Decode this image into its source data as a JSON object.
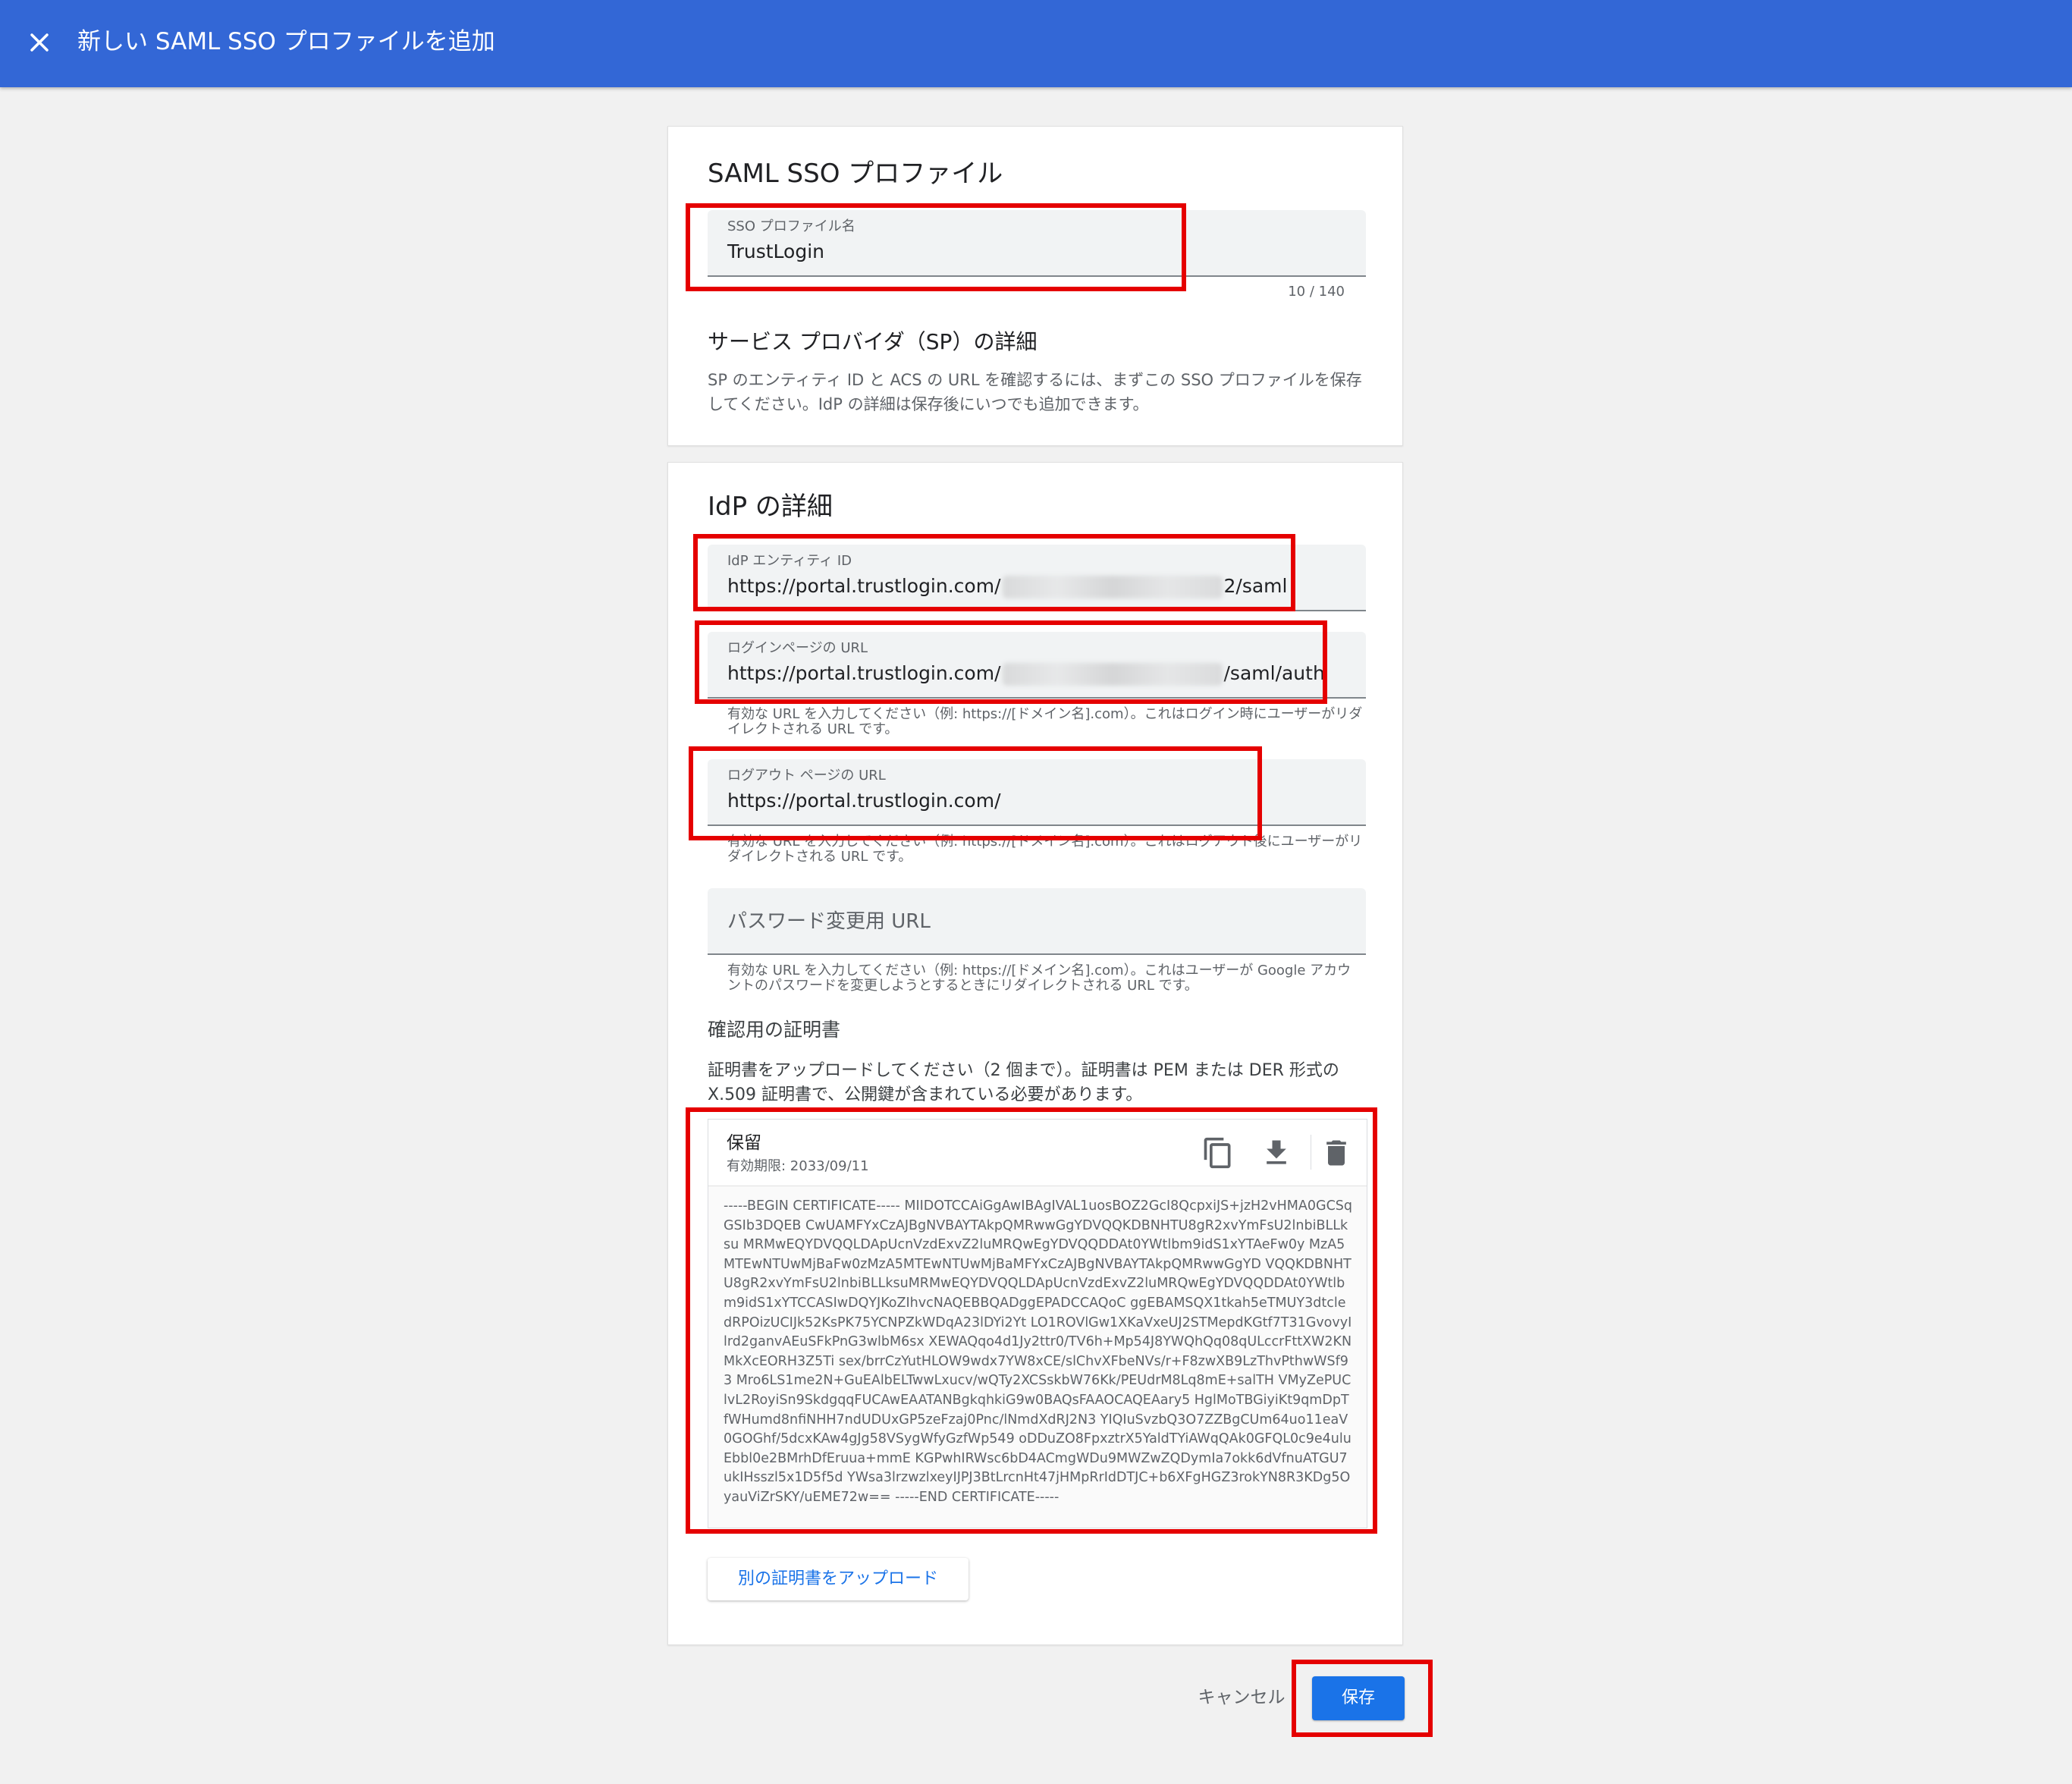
{
  "header": {
    "title": "新しい SAML SSO プロファイルを追加"
  },
  "profile_card": {
    "title": "SAML SSO プロファイル",
    "name_field": {
      "label": "SSO プロファイル名",
      "value": "TrustLogin",
      "counter": "10 / 140"
    },
    "sp_title": "サービス プロバイダ（SP）の詳細",
    "sp_desc": "SP のエンティティ ID と ACS の URL を確認するには、まずこの SSO プロファイルを保存してください。IdP の詳細は保存後にいつでも追加できます。"
  },
  "idp_card": {
    "title": "IdP の詳細",
    "entity_id": {
      "label": "IdP エンティティ ID",
      "value_prefix": "https://portal.trustlogin.com/",
      "value_suffix": "2/saml"
    },
    "login_url": {
      "label": "ログインページの URL",
      "value_prefix": "https://portal.trustlogin.com/",
      "value_suffix": "/saml/auth",
      "helper": "有効な URL を入力してください（例: https://[ドメイン名].com）。これはログイン時にユーザーがリダイレクトされる URL です。"
    },
    "logout_url": {
      "label": "ログアウト ページの URL",
      "value": "https://portal.trustlogin.com/",
      "helper": "有効な URL を入力してください（例: https://[ドメイン名].com）。これはログアウト後にユーザーがリダイレクトされる URL です。"
    },
    "password_url": {
      "placeholder": "パスワード変更用 URL",
      "helper": "有効な URL を入力してください（例: https://[ドメイン名].com）。これはユーザーが Google アカウントのパスワードを変更しようとするときにリダイレクトされる URL です。"
    },
    "cert_title": "確認用の証明書",
    "cert_desc": "証明書をアップロードしてください（2 個まで）。証明書は PEM または DER 形式の X.509 証明書で、公開鍵が含まれている必要があります。",
    "certificate": {
      "status": "保留",
      "expiry": "有効期限: 2033/09/11",
      "actions": [
        "copy-icon",
        "download-icon",
        "delete-icon"
      ],
      "text": "-----BEGIN CERTIFICATE----- MIIDOTCCAiGgAwIBAgIVAL1uosBOZ2GcI8QcpxiJS+jzH2vHMA0GCSqGSIb3DQEB CwUAMFYxCzAJBgNVBAYTAkpQMRwwGgYDVQQKDBNHTU8gR2xvYmFsU2lnbiBLLksu MRMwEQYDVQQLDApUcnVzdExvZ2luMRQwEgYDVQQDDAt0YWtlbm9idS1xYTAeFw0y MzA5MTEwNTUwMjBaFw0zMzA5MTEwNTUwMjBaMFYxCzAJBgNVBAYTAkpQMRwwGgYD VQQKDBNHTU8gR2xvYmFsU2lnbiBLLksuMRMwEQYDVQQLDApUcnVzdExvZ2luMRQwEgYDVQQDDAt0YWtlbm9idS1xYTCCASIwDQYJKoZIhvcNAQEBBQADggEPADCCAQoC ggEBAMSQX1tkah5eTMUY3dtcledRPOizUCIJk52KsPK75YCNPZkWDqA23lDYi2Yt LO1ROVlGw1XKaVxeUJ2STMepdKGtf7T31GvovyIlrd2ganvAEuSFkPnG3wlbM6sx XEWAQqo4d1Jy2ttr0/TV6h+Mp54J8YWQhQq08qULccrFttXW2KNMkXcEORH3Z5Ti sex/brrCzYutHLOW9wdx7YW8xCE/slChvXFbeNVs/r+F8zwXB9LzThvPthwWSf93 Mro6LS1me2N+GuEAlbELTwwLxucv/wQTy2XCSskbW76Kk/PEUdrM8Lq8mE+salTH VMyZePUClvL2RoyiSn9SkdgqqFUCAwEAATANBgkqhkiG9w0BAQsFAAOCAQEAary5 HglMoTBGiyiKt9qmDpTfWHumd8nfiNHH7ndUDUxGP5zeFzaj0Pnc/lNmdXdRJ2N3 YIQIuSvzbQ3O7ZZBgCUm64uo11eaV0GOGhf/5dcxKAw4gJg58VSygWfyGzfWp549 oDDuZO8FpxztrX5YaldTYiAWqQAk0GFQL0c9e4uluEbbl0e2BMrhDfEruua+mmE KGPwhIRWsc6bD4ACmgWDu9MWZwZQDymIa7okk6dVfnuATGU7ukIHsszl5x1D5f5d YWsa3lrzwzlxeyIJPJ3BtLrcnHt47jHMpRrIdDTJC+b6XFgHGZ3rokYN8R3KDg5O yauViZrSKY/uEME72w== -----END CERTIFICATE-----"
    },
    "upload_label": "別の証明書をアップロード"
  },
  "footer": {
    "cancel_label": "キャンセル",
    "save_label": "保存"
  },
  "colors": {
    "header_bg": "#3367d6",
    "primary": "#1a73e8",
    "highlight": "#e50000"
  }
}
